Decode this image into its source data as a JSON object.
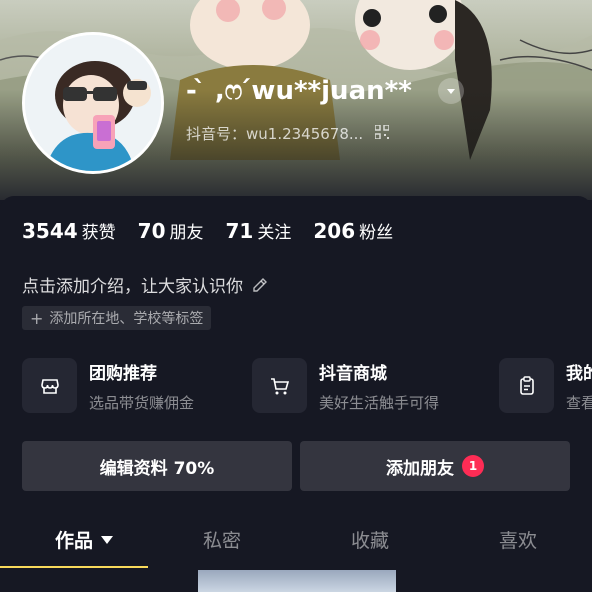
{
  "profile": {
    "nickname": "- ̀ ,ෆ ́wu**juan**",
    "douyin_id": "抖音号：wu1.2345678..."
  },
  "stats": [
    {
      "value": "3544",
      "label": "获赞"
    },
    {
      "value": "70",
      "label": "朋友"
    },
    {
      "value": "71",
      "label": "关注"
    },
    {
      "value": "206",
      "label": "粉丝"
    }
  ],
  "bio": {
    "text": "点击添加介绍，让大家认识你",
    "add_location": "添加所在地、学校等标签"
  },
  "services": [
    {
      "title": "团购推荐",
      "subtitle": "选品带货赚佣金",
      "icon": "shop-bag-icon"
    },
    {
      "title": "抖音商城",
      "subtitle": "美好生活触手可得",
      "icon": "cart-icon"
    },
    {
      "title": "我的",
      "subtitle": "查看",
      "icon": "order-list-icon"
    }
  ],
  "buttons": {
    "edit_profile": "编辑资料 70%",
    "add_friends": "添加朋友",
    "add_friends_badge": "1"
  },
  "tabs": [
    {
      "label": "作品",
      "active": true
    },
    {
      "label": "私密",
      "active": false
    },
    {
      "label": "收藏",
      "active": false
    },
    {
      "label": "喜欢",
      "active": false
    }
  ],
  "colors": {
    "background": "#161823",
    "accent_red": "#fe2c55",
    "tab_underline": "#f8d95b"
  }
}
